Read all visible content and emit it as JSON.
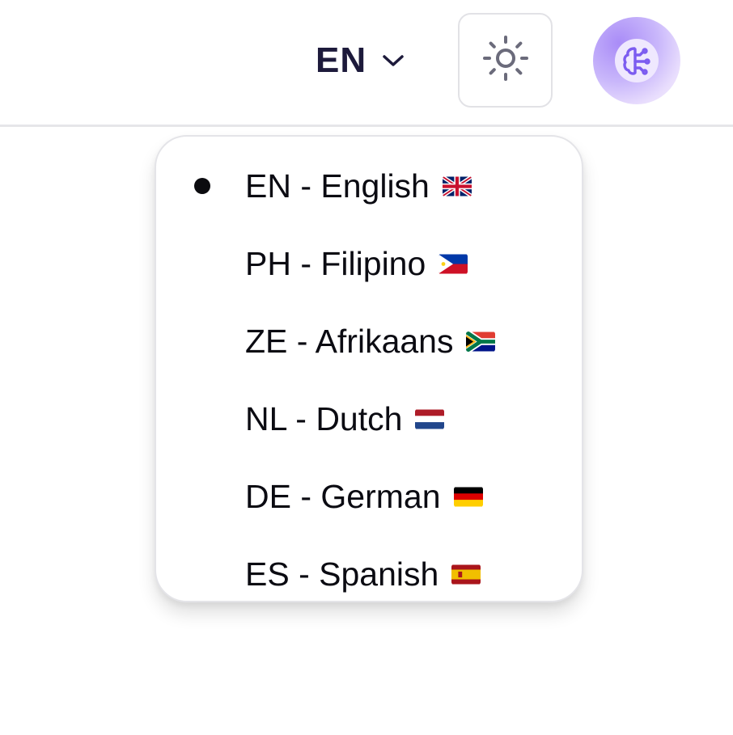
{
  "header": {
    "language_code": "EN",
    "theme_icon": "sun-icon",
    "avatar_icon": "brain-icon",
    "border_color": "#e6e6e9"
  },
  "language_menu": {
    "selected_index": 0,
    "items": [
      {
        "label": "EN - English",
        "flag": "flag-united-kingdom"
      },
      {
        "label": "PH - Filipino",
        "flag": "flag-philippines"
      },
      {
        "label": "ZE - Afrikaans",
        "flag": "flag-south-africa"
      },
      {
        "label": "NL - Dutch",
        "flag": "flag-netherlands"
      },
      {
        "label": "DE - German",
        "flag": "flag-germany"
      },
      {
        "label": "ES - Spanish",
        "flag": "flag-spain"
      }
    ]
  },
  "colors": {
    "text_dark": "#1d1a3b",
    "accent_purple": "#7c5cf0",
    "icon_gray": "#6b6b7b"
  }
}
